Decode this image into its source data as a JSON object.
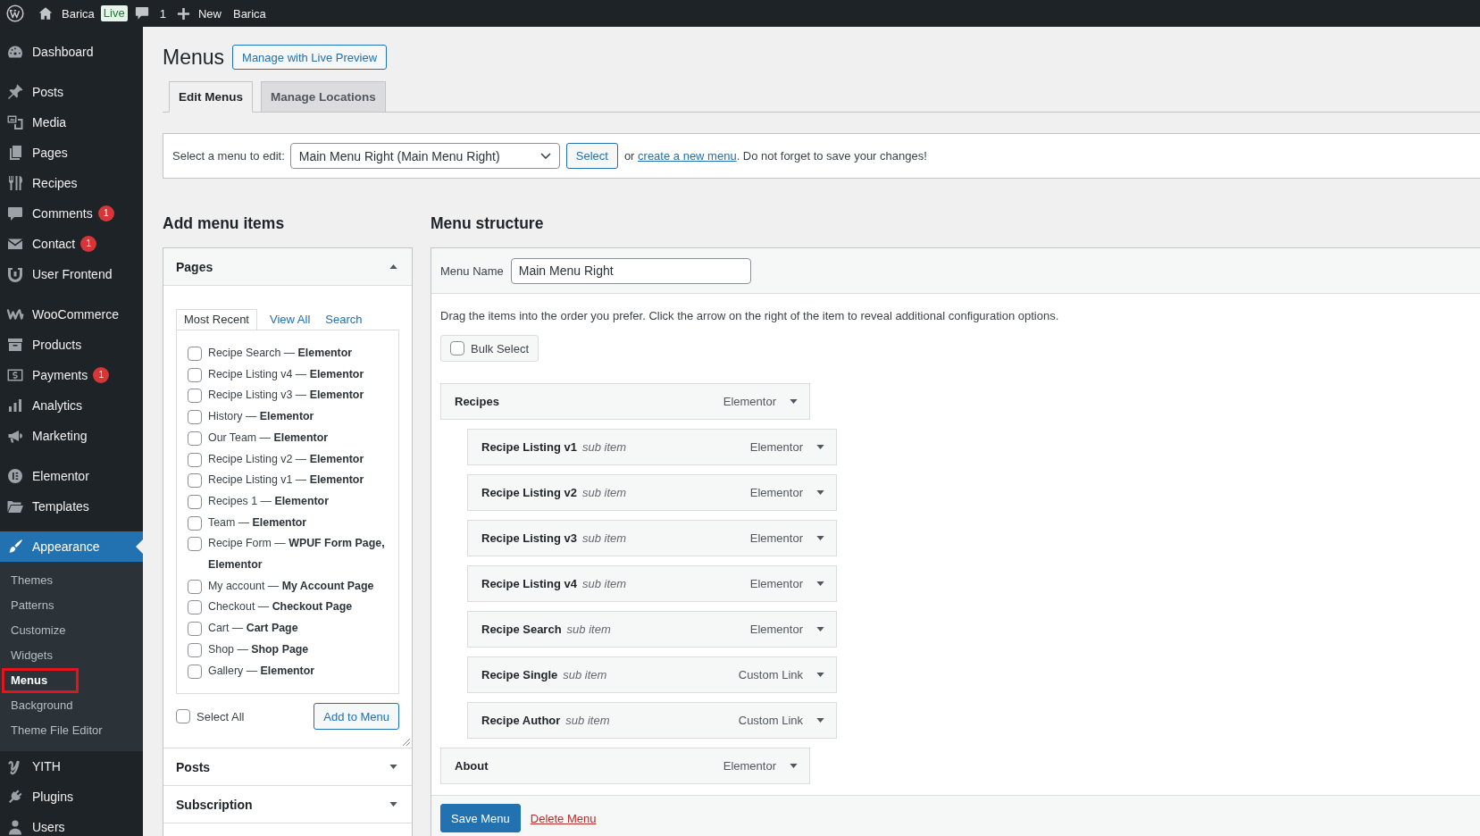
{
  "admin_bar": {
    "site_name": "Barica",
    "site_status": "Live",
    "comment_count": "1",
    "new_label": "New",
    "extra_item": "Barica"
  },
  "sidebar": {
    "groups": [
      {
        "items": [
          {
            "label": "Dashboard",
            "selected": false
          }
        ]
      },
      {
        "items": [
          {
            "label": "Posts",
            "selected": false
          },
          {
            "label": "Media",
            "selected": false
          },
          {
            "label": "Pages",
            "selected": false
          },
          {
            "label": "Recipes",
            "selected": false
          },
          {
            "label": "Comments",
            "selected": false,
            "badge": "1"
          },
          {
            "label": "Contact",
            "selected": false,
            "badge": "1"
          },
          {
            "label": "User Frontend",
            "selected": false
          }
        ]
      },
      {
        "items": [
          {
            "label": "WooCommerce",
            "selected": false
          },
          {
            "label": "Products",
            "selected": false
          },
          {
            "label": "Payments",
            "selected": false,
            "badge": "1"
          },
          {
            "label": "Analytics",
            "selected": false
          },
          {
            "label": "Marketing",
            "selected": false
          }
        ]
      },
      {
        "items": [
          {
            "label": "Elementor",
            "selected": false
          },
          {
            "label": "Templates",
            "selected": false
          }
        ]
      },
      {
        "items": [
          {
            "label": "Appearance",
            "selected": true,
            "children": [
              {
                "label": "Themes",
                "selected": false,
                "highlighted": false
              },
              {
                "label": "Patterns",
                "selected": false,
                "highlighted": false
              },
              {
                "label": "Customize",
                "selected": false,
                "highlighted": false
              },
              {
                "label": "Widgets",
                "selected": false,
                "highlighted": false
              },
              {
                "label": "Menus",
                "selected": true,
                "highlighted": true
              },
              {
                "label": "Background",
                "selected": false,
                "highlighted": false
              },
              {
                "label": "Theme File Editor",
                "selected": false,
                "highlighted": false
              }
            ]
          },
          {
            "label": "YITH",
            "selected": false
          },
          {
            "label": "Plugins",
            "selected": false
          },
          {
            "label": "Users",
            "selected": false
          }
        ]
      }
    ]
  },
  "page": {
    "title": "Menus",
    "live_preview_button": "Manage with Live Preview",
    "tabs": [
      {
        "label": "Edit Menus",
        "selected": true
      },
      {
        "label": "Manage Locations",
        "selected": false
      }
    ]
  },
  "menu_picker": {
    "label": "Select a menu to edit:",
    "value": "Main Menu Right (Main Menu Right)",
    "button": "Select",
    "note_before": "or",
    "note_link": "create a new menu",
    "note_after": ". Do not forget to save your changes!"
  },
  "add_menu_items": {
    "title": "Add menu items",
    "sections": [
      {
        "title": "Pages",
        "expanded": true,
        "tabs": [
          {
            "label": "Most Recent",
            "selected": true
          },
          {
            "label": "View All",
            "selected": false
          },
          {
            "label": "Search",
            "selected": false
          }
        ],
        "items": [
          {
            "label": "Recipe Search — **Elementor**",
            "checked": false
          },
          {
            "label": "Recipe Listing v4 — **Elementor**",
            "checked": false
          },
          {
            "label": "Recipe Listing v3 — **Elementor**",
            "checked": false
          },
          {
            "label": "History — **Elementor**",
            "checked": false
          },
          {
            "label": "Our Team — **Elementor**",
            "checked": false
          },
          {
            "label": "Recipe Listing v2 — **Elementor**",
            "checked": false
          },
          {
            "label": "Recipe Listing v1 — **Elementor**",
            "checked": false
          },
          {
            "label": "Recipes 1 — **Elementor**",
            "checked": false
          },
          {
            "label": "Team — **Elementor**",
            "checked": false
          },
          {
            "label": "Recipe Form — **WPUF Form Page, Elementor**",
            "checked": false
          },
          {
            "label": "My account — **My Account Page**",
            "checked": false
          },
          {
            "label": "Checkout — **Checkout Page**",
            "checked": false
          },
          {
            "label": "Cart — **Cart Page**",
            "checked": false
          },
          {
            "label": "Shop — **Shop Page**",
            "checked": false
          },
          {
            "label": "Gallery — **Elementor**",
            "checked": false
          }
        ],
        "select_all": {
          "label": "Select All",
          "checked": false
        },
        "button": "Add to Menu"
      },
      {
        "title": "Posts",
        "expanded": false
      },
      {
        "title": "Subscription",
        "expanded": false
      }
    ]
  },
  "menu_structure": {
    "title": "Menu structure",
    "name_label": "Menu Name",
    "name_value": "Main Menu Right",
    "instructions": "Drag the items into the order you prefer. Click the arrow on the right of the item to reveal additional configuration options.",
    "bulk_select": {
      "label": "Bulk Select",
      "checked": false
    },
    "items": [
      {
        "title": "Recipes",
        "type": "Elementor",
        "children": [
          {
            "title": "Recipe Listing v1",
            "note": "sub item",
            "type": "Elementor"
          },
          {
            "title": "Recipe Listing v2",
            "note": "sub item",
            "type": "Elementor"
          },
          {
            "title": "Recipe Listing v3",
            "note": "sub item",
            "type": "Elementor"
          },
          {
            "title": "Recipe Listing v4",
            "note": "sub item",
            "type": "Elementor"
          },
          {
            "title": "Recipe Search",
            "note": "sub item",
            "type": "Elementor"
          },
          {
            "title": "Recipe Single",
            "note": "sub item",
            "type": "Custom Link"
          },
          {
            "title": "Recipe Author",
            "note": "sub item",
            "type": "Custom Link"
          }
        ]
      },
      {
        "title": "About",
        "type": "Elementor"
      }
    ],
    "save_button": "Save Menu",
    "delete_link": "Delete Menu"
  }
}
